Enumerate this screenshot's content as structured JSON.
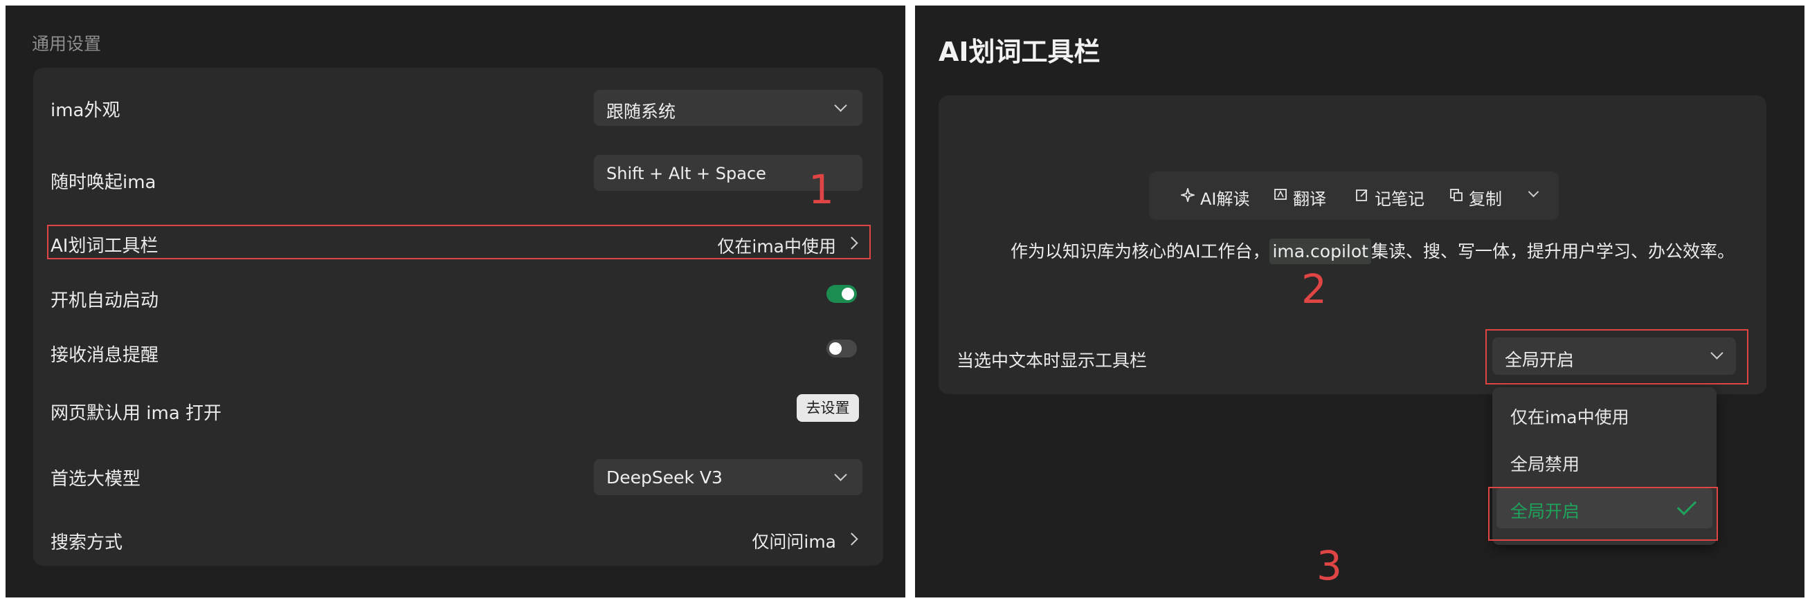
{
  "left_panel": {
    "section_title": "通用设置",
    "rows": {
      "appearance": {
        "label": "ima外观",
        "value": "跟随系统"
      },
      "hotkey": {
        "label": "随时唤起ima",
        "value": "Shift + Alt + Space"
      },
      "ai_toolbar": {
        "label": "AI划词工具栏",
        "value": "仅在ima中使用"
      },
      "autostart": {
        "label": "开机自动启动",
        "enabled": true
      },
      "notifications": {
        "label": "接收消息提醒",
        "enabled": false
      },
      "web_default": {
        "label": "网页默认用 ima 打开",
        "button": "去设置"
      },
      "model": {
        "label": "首选大模型",
        "value": "DeepSeek V3"
      },
      "search": {
        "label": "搜索方式",
        "value": "仅问问ima"
      }
    },
    "annotation_number": "1"
  },
  "right_panel": {
    "title": "AI划词工具栏",
    "toolbar": {
      "ai_read": "AI解读",
      "translate": "翻译",
      "note": "记笔记",
      "copy": "复制"
    },
    "demo_text": {
      "before": "作为以知识库为核心的AI工作台，",
      "highlight": "ima.copilot",
      "after": "集读、搜、写一体，提升用户学习、办公效率。"
    },
    "show_toolbar_label": "当选中文本时显示工具栏",
    "select_value": "全局开启",
    "options": [
      "仅在ima中使用",
      "全局禁用",
      "全局开启"
    ],
    "selected_option": "全局开启",
    "annotation_numbers": [
      "2",
      "3"
    ]
  },
  "colors": {
    "panel_bg": "#1f1f1f",
    "card_bg": "#2a2a2a",
    "accent_green": "#1fa35c",
    "annotation_red": "#e04545"
  },
  "icons": [
    "chevron-down-icon",
    "chevron-right-icon",
    "sparkle-icon",
    "translate-icon",
    "note-icon",
    "copy-icon",
    "check-icon"
  ]
}
